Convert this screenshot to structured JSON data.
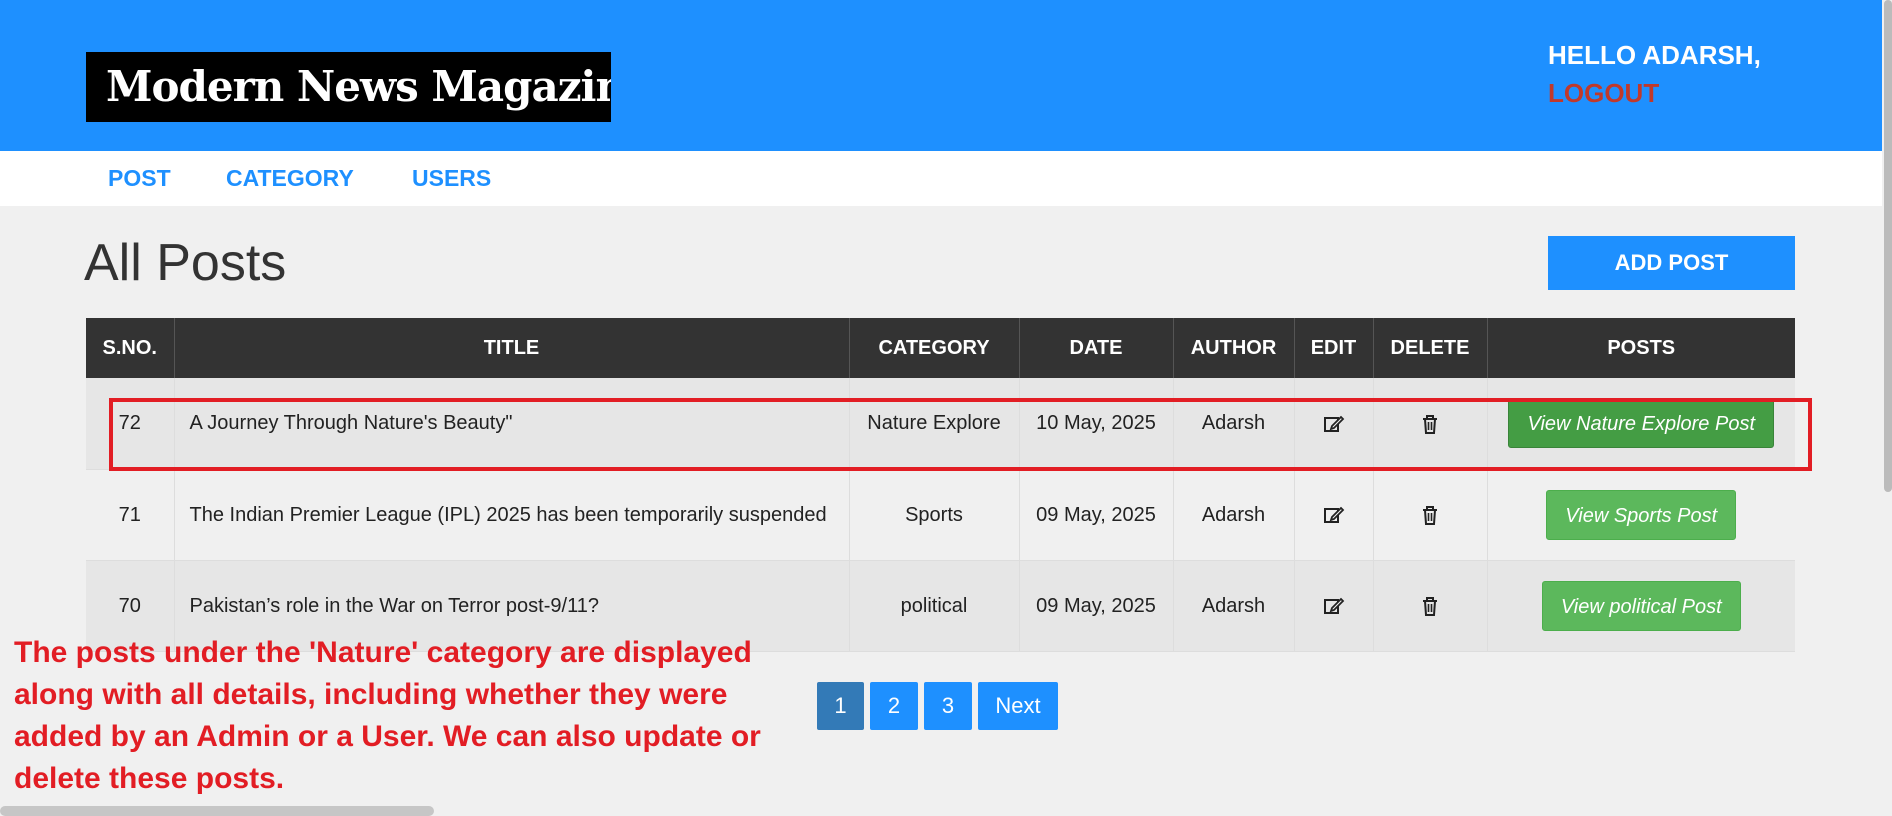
{
  "header": {
    "logo": "Modern News Magazines",
    "greeting": "HELLO ADARSH,",
    "logout": "LOGOUT"
  },
  "nav": {
    "items": [
      {
        "label": "POST"
      },
      {
        "label": "CATEGORY"
      },
      {
        "label": "USERS"
      }
    ]
  },
  "main": {
    "title": "All Posts",
    "add_button": "ADD POST"
  },
  "table": {
    "headers": [
      "S.NO.",
      "TITLE",
      "CATEGORY",
      "DATE",
      "AUTHOR",
      "EDIT",
      "DELETE",
      "POSTS"
    ],
    "rows": [
      {
        "sno": "72",
        "title": "A Journey Through Nature's Beauty\"",
        "category": "Nature Explore",
        "date": "10 May, 2025",
        "author": "Adarsh",
        "view": "View Nature Explore Post"
      },
      {
        "sno": "71",
        "title": "The Indian Premier League (IPL) 2025 has been temporarily suspended",
        "category": "Sports",
        "date": "09 May, 2025",
        "author": "Adarsh",
        "view": "View Sports Post"
      },
      {
        "sno": "70",
        "title": "Pakistan’s role in the War on Terror post-9/11?",
        "category": "political",
        "date": "09 May, 2025",
        "author": "Adarsh",
        "view": "View political Post"
      }
    ],
    "icons": {
      "edit": "edit-icon",
      "delete": "trash-icon"
    }
  },
  "pagination": {
    "pages": [
      "1",
      "2",
      "3"
    ],
    "next": "Next",
    "current": "1"
  },
  "annotation": {
    "text": "The posts under the 'Nature' category are displayed along with all details, including whether they were added by an Admin or a User. We can also update or delete these posts."
  },
  "colors": {
    "primary": "#1e90ff",
    "logout": "#c0392b",
    "annotation": "#e21d24",
    "view_button": "#5cb85c",
    "view_button_dark": "#449d44",
    "table_header": "#333333"
  }
}
